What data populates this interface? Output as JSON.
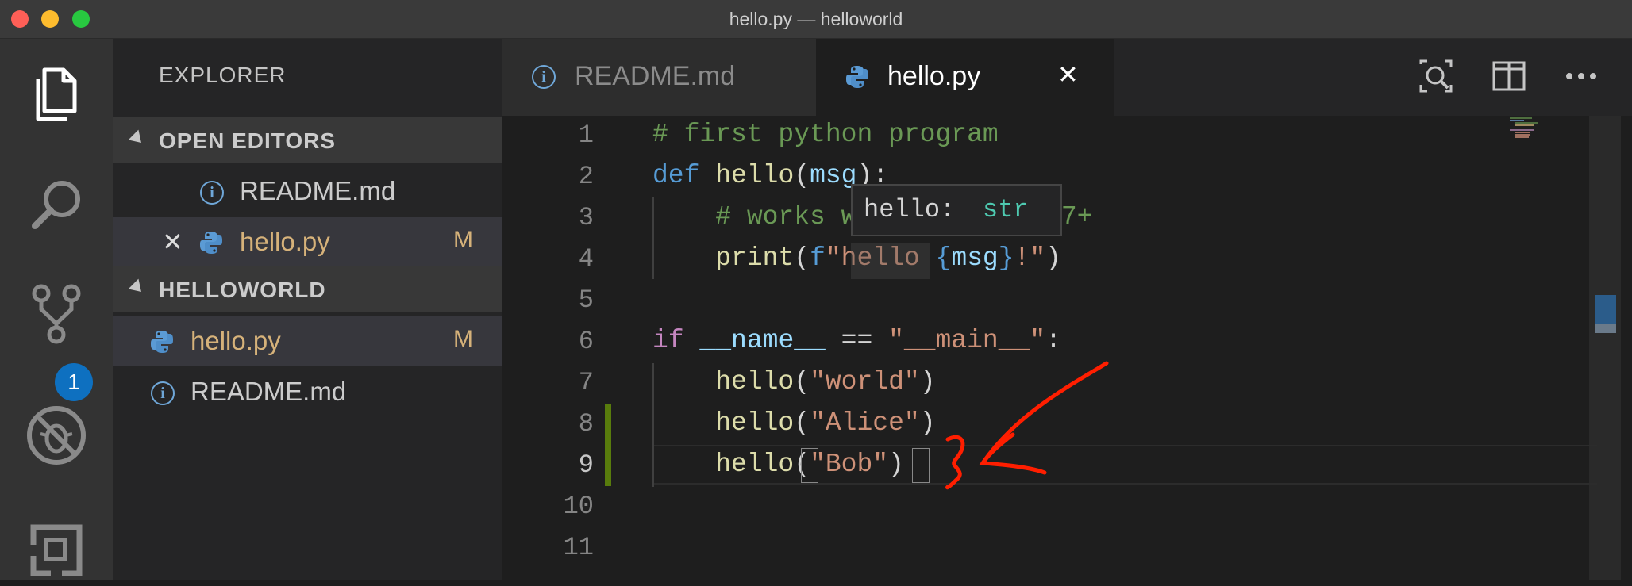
{
  "window": {
    "title": "hello.py — helloworld"
  },
  "activity_bar": {
    "scm_badge": "1"
  },
  "sidebar": {
    "title": "EXPLORER",
    "open_editors": {
      "header": "OPEN EDITORS",
      "items": [
        {
          "label": "README.md",
          "icon": "info-icon"
        },
        {
          "label": "hello.py",
          "icon": "python-icon",
          "status": "M"
        }
      ]
    },
    "folder": {
      "header": "HELLOWORLD",
      "items": [
        {
          "label": "hello.py",
          "icon": "python-icon",
          "status": "M"
        },
        {
          "label": "README.md",
          "icon": "info-icon"
        }
      ]
    }
  },
  "tabs": [
    {
      "label": "README.md",
      "icon": "info-icon"
    },
    {
      "label": "hello.py",
      "icon": "python-icon",
      "close": "✕"
    }
  ],
  "editor": {
    "line_numbers": [
      "1",
      "2",
      "3",
      "4",
      "5",
      "6",
      "7",
      "8",
      "9",
      "10",
      "11"
    ],
    "lines": [
      "# first python program",
      "def hello(msg):",
      "    # works with python 3.7+",
      "    print(f\"hello {msg}!\")",
      "",
      "if __name__ == \"__main__\":",
      "    hello(\"world\")",
      "    hello(\"Alice\")",
      "    hello(\"Bob\")",
      "",
      ""
    ],
    "hover": {
      "name": "hello:",
      "type": "str"
    }
  },
  "colors": {
    "keyword": "#569cd6",
    "control": "#c586c0",
    "function": "#dcdcaa",
    "string": "#ce9178",
    "variable": "#9cdcfe",
    "comment": "#6a9955",
    "modified": "#d6b27a",
    "badge": "#0e70c0",
    "annotation": "#ff1e00"
  }
}
